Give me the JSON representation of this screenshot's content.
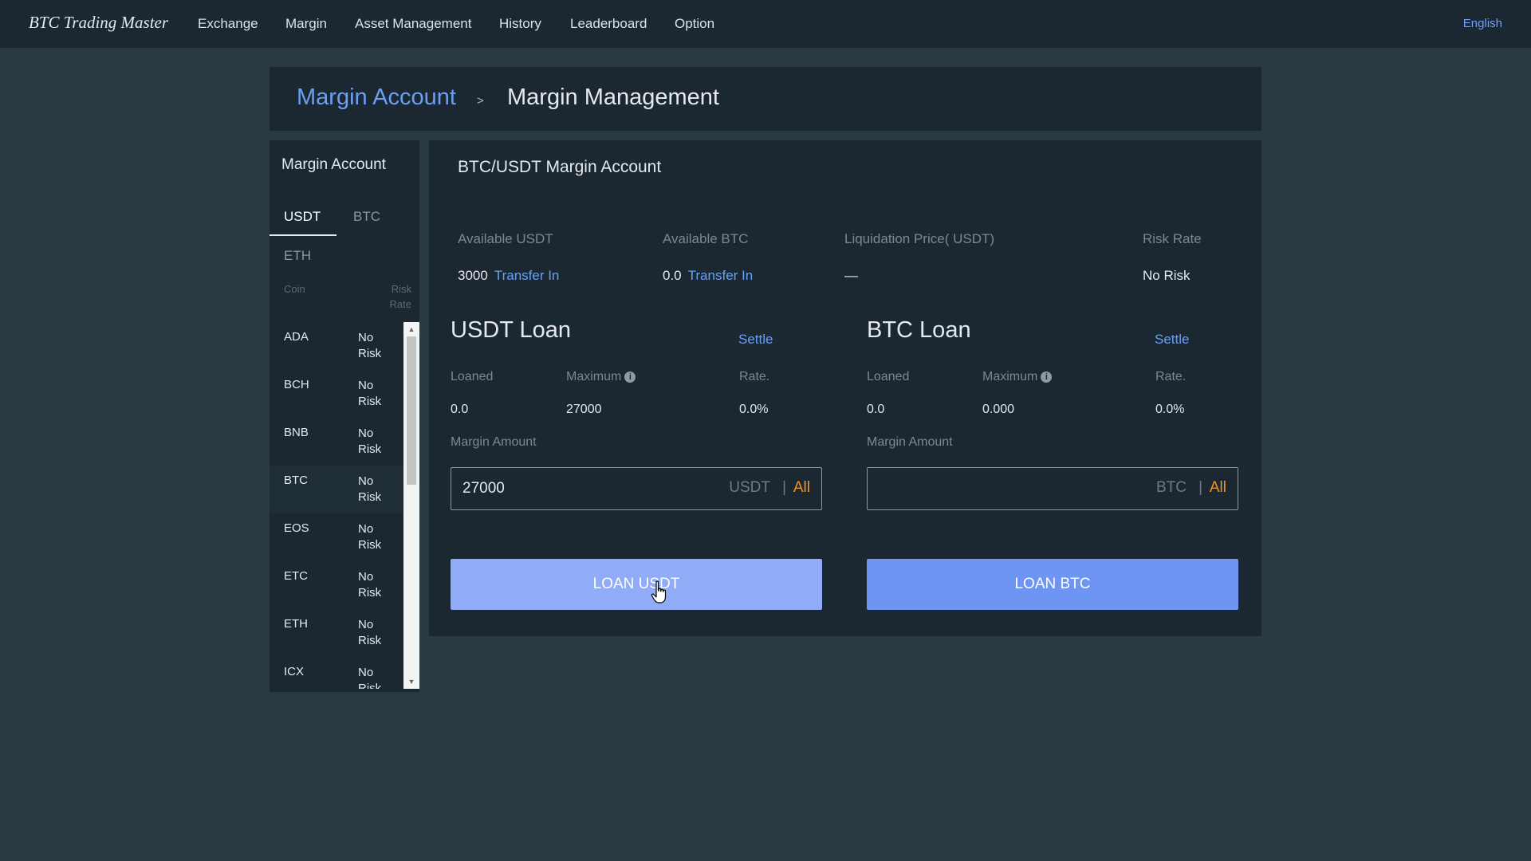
{
  "header": {
    "brand": "BTC Trading Master",
    "nav": [
      "Exchange",
      "Margin",
      "Asset Management",
      "History",
      "Leaderboard",
      "Option"
    ],
    "language": "English"
  },
  "breadcrumb": {
    "parent": "Margin Account",
    "separator": ">",
    "current": "Margin Management"
  },
  "sidebar": {
    "title": "Margin Account",
    "tabs": [
      "USDT",
      "BTC",
      "ETH"
    ],
    "active_tab": "USDT",
    "columns": {
      "coin": "Coin",
      "risk_rate_1": "Risk",
      "risk_rate_2": "Rate"
    },
    "coins": [
      {
        "name": "ADA",
        "risk_1": "No",
        "risk_2": "Risk"
      },
      {
        "name": "BCH",
        "risk_1": "No",
        "risk_2": "Risk"
      },
      {
        "name": "BNB",
        "risk_1": "No",
        "risk_2": "Risk"
      },
      {
        "name": "BTC",
        "risk_1": "No",
        "risk_2": "Risk"
      },
      {
        "name": "EOS",
        "risk_1": "No",
        "risk_2": "Risk"
      },
      {
        "name": "ETC",
        "risk_1": "No",
        "risk_2": "Risk"
      },
      {
        "name": "ETH",
        "risk_1": "No",
        "risk_2": "Risk"
      },
      {
        "name": "ICX",
        "risk_1": "No",
        "risk_2": "Risk"
      }
    ],
    "selected_coin": "BTC"
  },
  "account": {
    "title": "BTC/USDT Margin Account",
    "available_usdt_label": "Available USDT",
    "available_usdt": "3000",
    "available_btc_label": "Available BTC",
    "available_btc": "0.0",
    "transfer_in": "Transfer In",
    "liquidation_label": "Liquidation Price( USDT)",
    "liquidation_value": "—",
    "risk_rate_label": "Risk Rate",
    "risk_rate_value": "No Risk"
  },
  "usdt_loan": {
    "title": "USDT Loan",
    "settle": "Settle",
    "loaned_label": "Loaned",
    "loaned": "0.0",
    "maximum_label": "Maximum",
    "maximum": "27000",
    "rate_label": "Rate.",
    "rate": "0.0%",
    "amount_label": "Margin Amount",
    "amount_value": "27000",
    "unit": "USDT",
    "all": "All",
    "button": "LOAN USDT"
  },
  "btc_loan": {
    "title": "BTC Loan",
    "settle": "Settle",
    "loaned_label": "Loaned",
    "loaned": "0.0",
    "maximum_label": "Maximum",
    "maximum": "0.000",
    "rate_label": "Rate.",
    "rate": "0.0%",
    "amount_label": "Margin Amount",
    "amount_value": "",
    "unit": "BTC",
    "all": "All",
    "button": "LOAN BTC"
  },
  "icons": {
    "info": "info-icon",
    "cursor": "hand-pointer-icon",
    "scroll_up": "scroll-up-arrow-icon",
    "scroll_down": "scroll-down-arrow-icon"
  },
  "colors": {
    "background": "#2a3a43",
    "panel": "#1b2731",
    "link": "#6aa0f3",
    "accent_all": "#f0932b",
    "button": "#6e94f4",
    "button_hover": "#91acf6"
  }
}
